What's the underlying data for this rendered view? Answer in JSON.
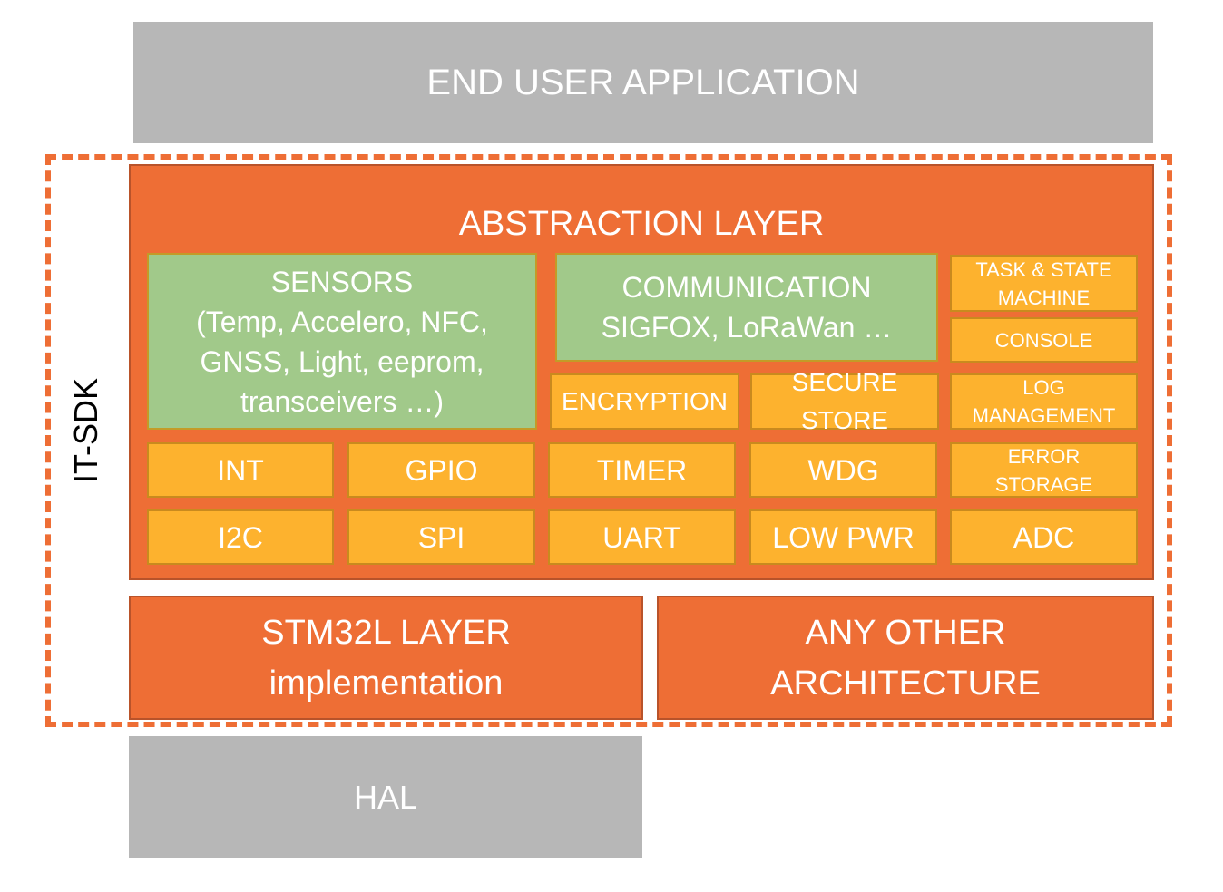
{
  "top": {
    "label": "END USER APPLICATION",
    "color": "#b7b7b7"
  },
  "sdk": {
    "label": "IT-SDK",
    "border_color": "#ee6e35"
  },
  "abstraction": {
    "title": "ABSTRACTION LAYER",
    "color": "#ee6e35"
  },
  "sensors": {
    "label": "SENSORS\n(Temp, Accelero, NFC,\nGNSS, Light, eeprom,\ntransceivers …)"
  },
  "communication": {
    "label": "COMMUNICATION\nSIGFOX, LoRaWan …"
  },
  "services": {
    "task": "TASK & STATE\nMACHINE",
    "console": "CONSOLE",
    "encryption": "ENCRYPTION",
    "secure_store": "SECURE STORE",
    "log": "LOG\nMANAGEMENT",
    "error": "ERROR\nSTORAGE"
  },
  "drivers_row1": [
    "INT",
    "GPIO",
    "TIMER",
    "WDG"
  ],
  "drivers_row2": [
    "I2C",
    "SPI",
    "UART",
    "LOW PWR",
    "ADC"
  ],
  "stm32": {
    "label": "STM32L LAYER\nimplementation"
  },
  "other_arch": {
    "label": "ANY OTHER\nARCHITECTURE"
  },
  "hal": {
    "label": "HAL"
  }
}
